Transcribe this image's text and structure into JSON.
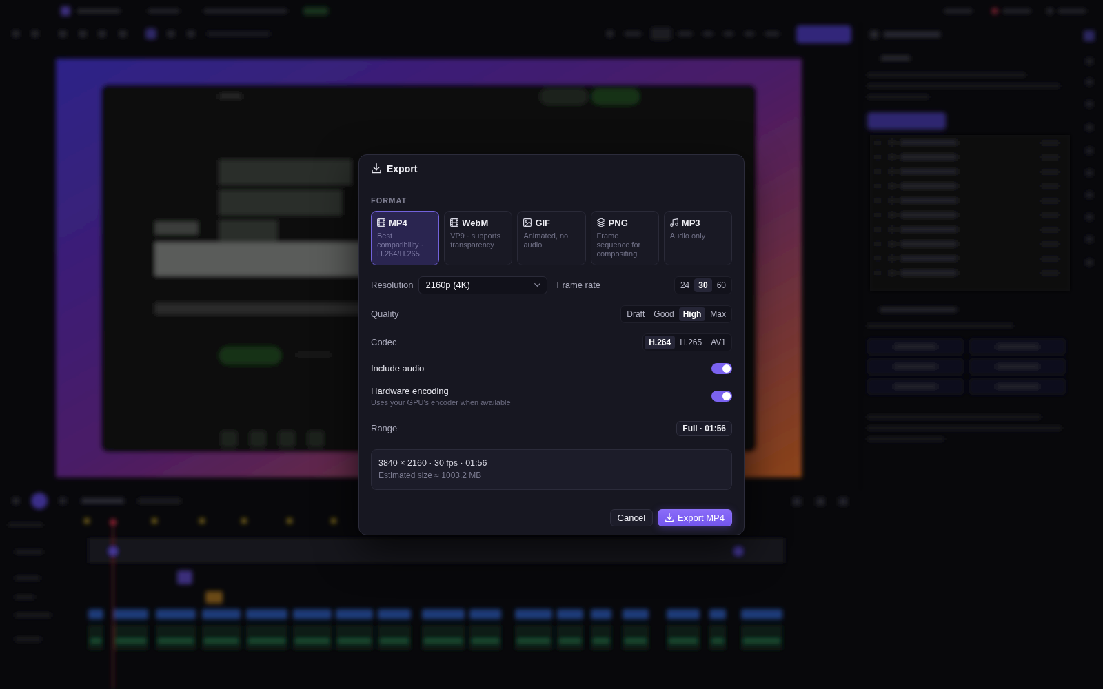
{
  "dialog": {
    "title": "Export",
    "format_label": "FORMAT",
    "formats": [
      {
        "kind": "film",
        "name": "MP4",
        "description": "Best compatibility · H.264/H.265",
        "selected": true
      },
      {
        "kind": "film",
        "name": "WebM",
        "description": "VP9 · supports transparency",
        "selected": false
      },
      {
        "kind": "image",
        "name": "GIF",
        "description": "Animated, no audio",
        "selected": false
      },
      {
        "kind": "layers",
        "name": "PNG",
        "description": "Frame sequence for compositing",
        "selected": false
      },
      {
        "kind": "music",
        "name": "MP3",
        "description": "Audio only",
        "selected": false
      }
    ],
    "resolution": {
      "label": "Resolution",
      "value": "2160p (4K)"
    },
    "frame_rate": {
      "label": "Frame rate",
      "options": [
        {
          "label": "24",
          "selected": false
        },
        {
          "label": "30",
          "selected": true
        },
        {
          "label": "60",
          "selected": false
        }
      ]
    },
    "quality": {
      "label": "Quality",
      "options": [
        {
          "label": "Draft",
          "selected": false
        },
        {
          "label": "Good",
          "selected": false
        },
        {
          "label": "High",
          "selected": true
        },
        {
          "label": "Max",
          "selected": false
        }
      ]
    },
    "codec": {
      "label": "Codec",
      "options": [
        {
          "label": "H.264",
          "selected": true
        },
        {
          "label": "H.265",
          "selected": false
        },
        {
          "label": "AV1",
          "selected": false
        }
      ]
    },
    "include_audio": {
      "label": "Include audio",
      "on": true
    },
    "hardware_encoding": {
      "label": "Hardware encoding",
      "description": "Uses your GPU's encoder when available",
      "on": true
    },
    "range": {
      "label": "Range",
      "value": "Full · 01:56"
    },
    "summary": {
      "line_1": "3840 × 2160 · 30 fps · 01:56",
      "line_2": "Estimated size ≈ 1003.2 MB"
    },
    "buttons": [
      {
        "kind": "secondary",
        "label": "Cancel"
      },
      {
        "kind": "primary",
        "label": "Export MP4"
      }
    ]
  }
}
